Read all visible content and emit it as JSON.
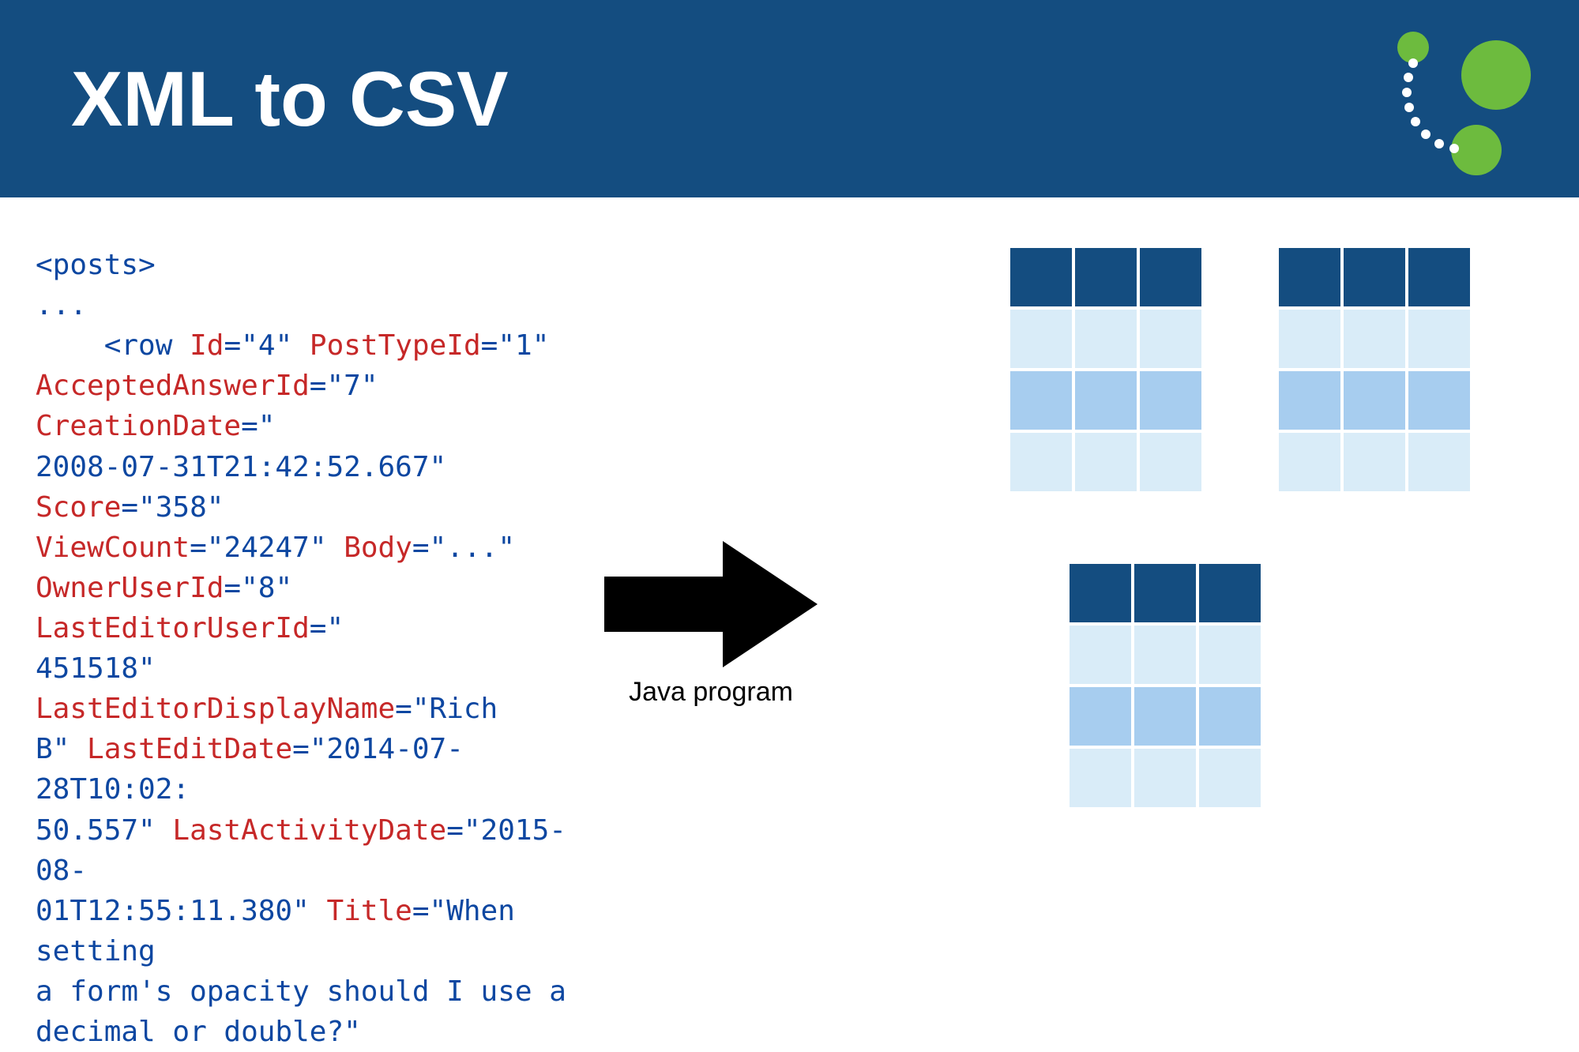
{
  "header": {
    "title": "XML to CSV"
  },
  "code": {
    "posts_open": "<posts>",
    "ellipsis": "...",
    "row_open": "<row",
    "attrs": {
      "Id": "4",
      "PostTypeId": "1",
      "AcceptedAnswerId": "7",
      "CreationDate": "2008-07-31T21:42:52.667",
      "Score": "358",
      "ViewCount": "24247",
      "Body": "...",
      "OwnerUserId": "8",
      "LastEditorUserId": "451518",
      "LastEditorDisplayName": "Rich B",
      "LastEditDate": "2014-07-28T10:02:50.557",
      "LastActivityDate": "2015-08-01T12:55:11.380",
      "Title": "When setting a form's opacity should I use a decimal or double?"
    }
  },
  "arrow_label": "Java program",
  "table_colors": {
    "header": "#144d80",
    "light": "#d9ecf8",
    "mid": "#a7cdef"
  },
  "tables": {
    "t1": {
      "cols": 3,
      "rows": 4
    },
    "t2": {
      "cols": 3,
      "rows": 4
    },
    "t3": {
      "cols": 3,
      "rows": 4
    }
  }
}
